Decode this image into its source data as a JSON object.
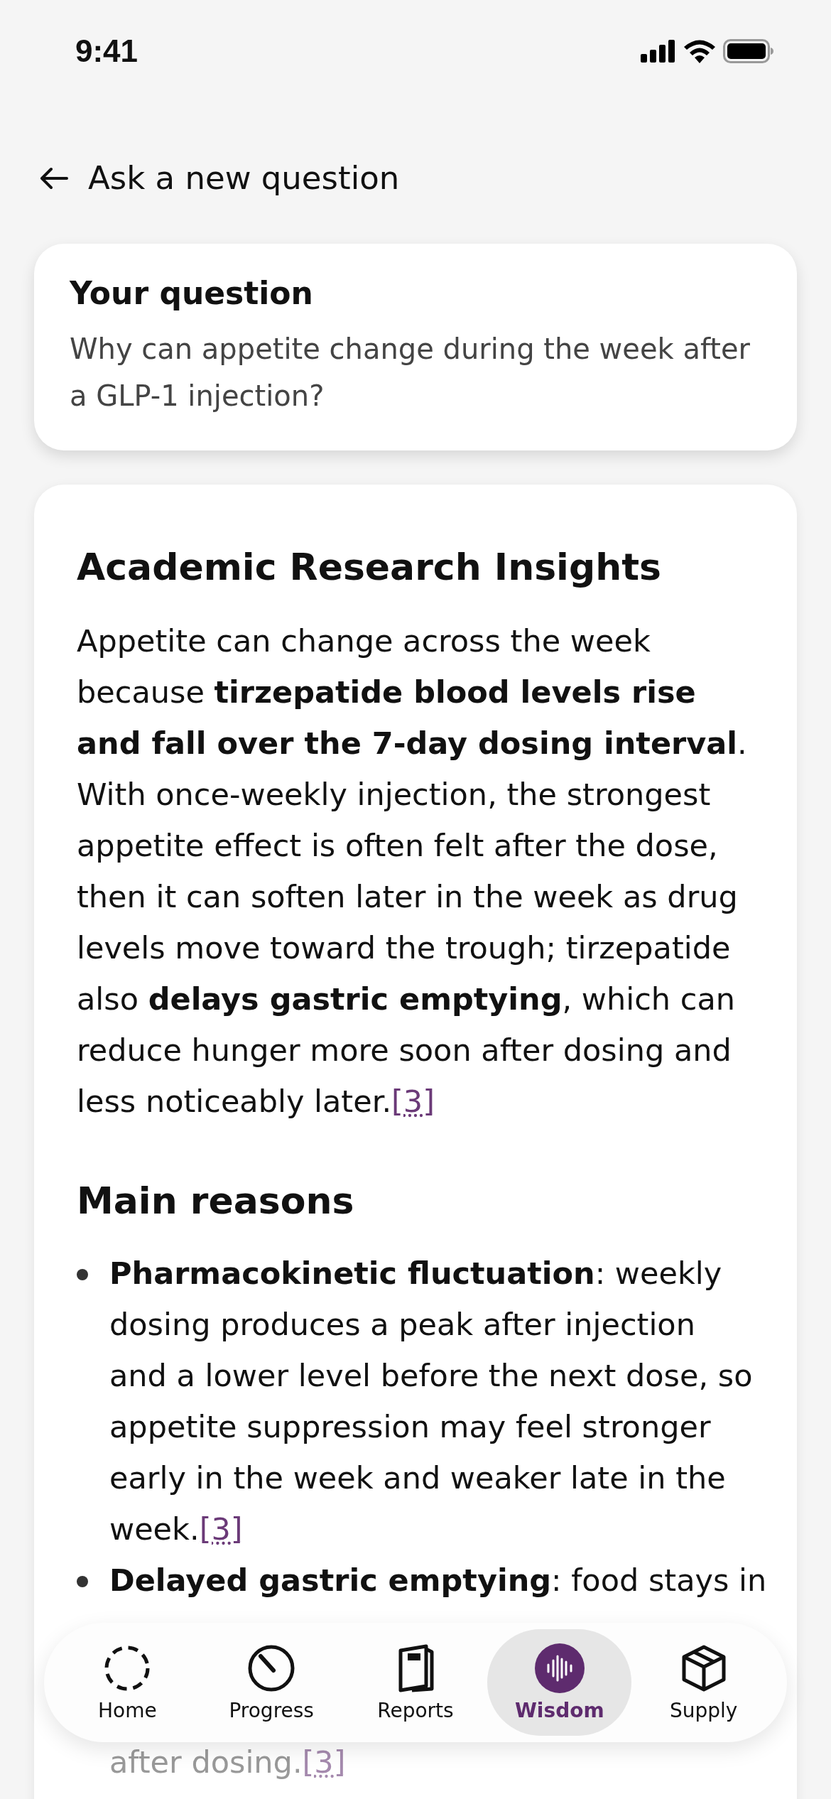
{
  "status_bar": {
    "time": "9:41"
  },
  "back": {
    "label": "Ask a new question"
  },
  "question": {
    "title": "Your question",
    "text": "Why can appetite change during the week after a GLP-1 injection?"
  },
  "answer": {
    "title": "Academic Research Insights",
    "paragraph": {
      "text": "Appetite can change across the week because **tirzepatide blood levels rise and fall over the 7-day dosing interval**. With once-weekly injection, the strongest appetite effect is often felt after the dose, then it can soften later in the week as drug levels move toward the trough; tirzepatide also **delays gastric emptying**, which can reduce hunger more soon after dosing and less noticeably later.",
      "citation": "[3]"
    },
    "section_title": "Main reasons",
    "bullets": [
      {
        "text": "**Pharmacokinetic fluctuation**: weekly dosing produces a peak after injection and a lower level before the next dose, so appetite suppression may feel stronger early in the week and weaker late in the week.",
        "citation": "[3]"
      },
      {
        "text": "**Delayed gastric emptying**: food stays in"
      }
    ],
    "bullet_tail": {
      "text": "after dosing.",
      "citation": "[3]"
    }
  },
  "nav": [
    {
      "kind": "home",
      "label": "Home",
      "selected": false
    },
    {
      "kind": "progress",
      "label": "Progress",
      "selected": false
    },
    {
      "kind": "reports",
      "label": "Reports",
      "selected": false
    },
    {
      "kind": "wisdom",
      "label": "Wisdom",
      "selected": true
    },
    {
      "kind": "supply",
      "label": "Supply",
      "selected": false
    }
  ]
}
